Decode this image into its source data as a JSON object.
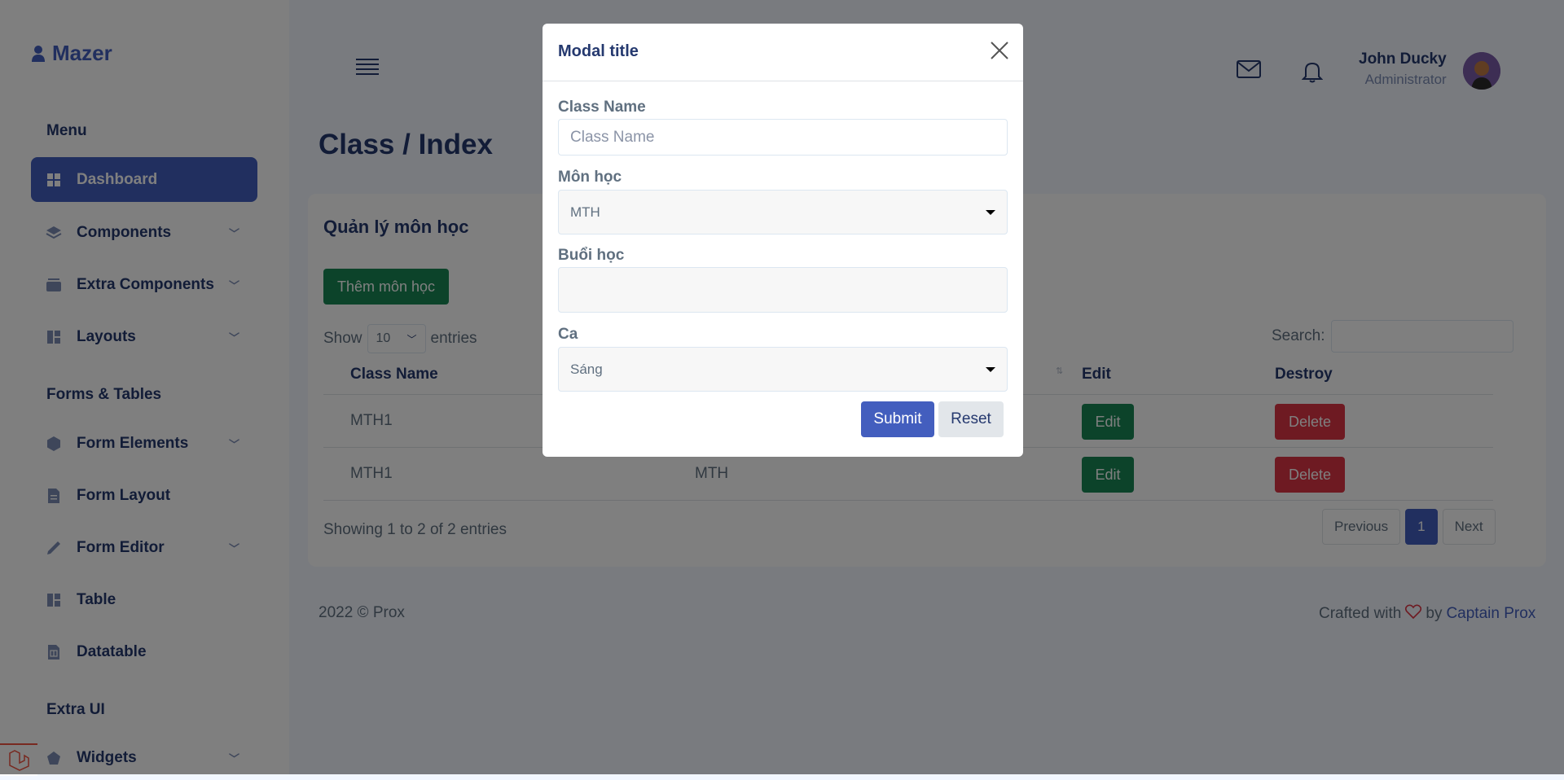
{
  "app": {
    "name": "Mazer"
  },
  "sidebar": {
    "sections": [
      {
        "title": "Menu"
      },
      {
        "title": "Forms & Tables"
      },
      {
        "title": "Extra UI"
      }
    ],
    "items": [
      {
        "label": "Dashboard",
        "icon": "grid-icon",
        "active": true
      },
      {
        "label": "Components",
        "icon": "stack-icon"
      },
      {
        "label": "Extra Components",
        "icon": "collection-icon"
      },
      {
        "label": "Layouts",
        "icon": "layout-icon"
      },
      {
        "label": "Form Elements",
        "icon": "hexagon-icon"
      },
      {
        "label": "Form Layout",
        "icon": "file-text-icon"
      },
      {
        "label": "Form Editor",
        "icon": "pen-icon"
      },
      {
        "label": "Table",
        "icon": "grid-1x2-icon"
      },
      {
        "label": "Datatable",
        "icon": "file-spreadsheet-icon"
      },
      {
        "label": "Widgets",
        "icon": "pentagon-icon"
      }
    ]
  },
  "header": {
    "user_name": "John Ducky",
    "user_role": "Administrator"
  },
  "page": {
    "title": "Class / Index"
  },
  "card": {
    "title": "Quản lý môn học",
    "add_button": "Thêm môn học",
    "show_label": "Show",
    "entries_value": "10",
    "entries_label": "entries",
    "search_label": "Search:",
    "columns": [
      "Class Name",
      "Edit",
      "Destroy"
    ],
    "rows": [
      {
        "class_name": "MTH1",
        "subject": "",
        "edit": "Edit",
        "delete": "Delete"
      },
      {
        "class_name": "MTH1",
        "subject": "MTH",
        "edit": "Edit",
        "delete": "Delete"
      }
    ],
    "info": "Showing 1 to 2 of 2 entries",
    "pagination": {
      "previous": "Previous",
      "current": "1",
      "next": "Next"
    }
  },
  "footer": {
    "copyright": "2022 © Prox",
    "crafted": "Crafted with",
    "by": "by",
    "author": "Captain Prox"
  },
  "modal": {
    "title": "Modal title",
    "fields": {
      "class_name_label": "Class Name",
      "class_name_placeholder": "Class Name",
      "subject_label": "Môn học",
      "subject_value": "MTH",
      "session_label": "Buổi học",
      "session_value": "",
      "shift_label": "Ca",
      "shift_value": "Sáng"
    },
    "submit": "Submit",
    "reset": "Reset"
  },
  "colors": {
    "primary": "#435ebe",
    "success": "#198754",
    "danger": "#dc3545"
  }
}
